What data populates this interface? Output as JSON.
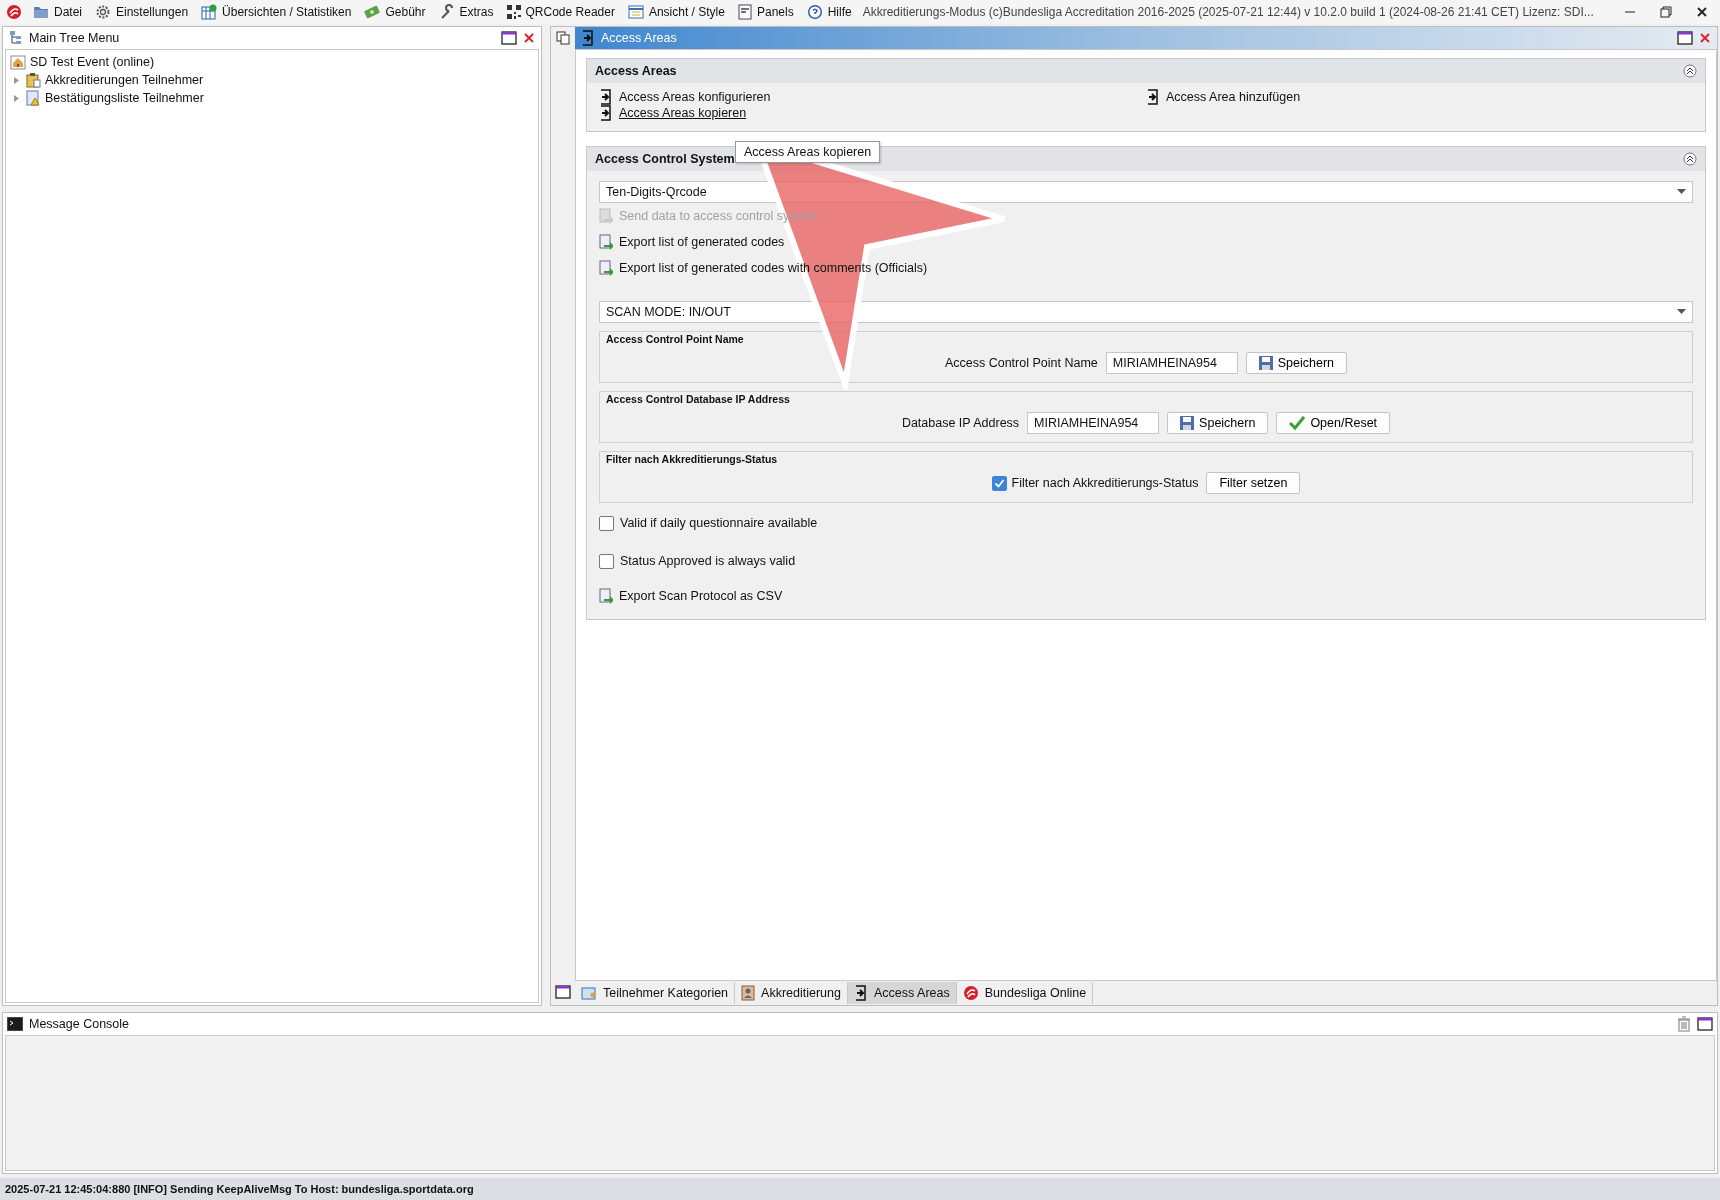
{
  "menu_bar": {
    "items": [
      {
        "label": "Datei"
      },
      {
        "label": "Einstellungen"
      },
      {
        "label": "Übersichten / Statistiken"
      },
      {
        "label": "Gebühr"
      },
      {
        "label": "Extras"
      },
      {
        "label": "QRCode Reader"
      },
      {
        "label": "Ansicht / Style"
      },
      {
        "label": "Panels"
      },
      {
        "label": "Hilfe"
      }
    ],
    "title": "Akkreditierungs-Modus (c)Bundesliga Accreditation 2016-2025 (2025-07-21 12:44) v 10.2.0 build 1 (2024-08-26 21:41 CET) Lizenz: SDI..."
  },
  "left_panel": {
    "title": "Main Tree Menu",
    "tree": [
      {
        "label": "SD Test Event (online)",
        "children": [
          {
            "label": "Akkreditierungen Teilnehmer",
            "expanded": false
          },
          {
            "label": "Bestätigungsliste Teilnehmer",
            "expanded": false
          }
        ]
      }
    ]
  },
  "main_panel": {
    "title": "Access Areas",
    "areas_section": {
      "title": "Access Areas",
      "links": [
        {
          "label": "Access Areas konfigurieren",
          "hovered": false
        },
        {
          "label": "Access Areas kopieren",
          "hovered": true
        }
      ],
      "right_link": {
        "label": "Access Area hinzufügen",
        "hovered": false
      },
      "tooltip": "Access Areas kopieren"
    },
    "acs_section": {
      "title": "Access Control System",
      "system": "Ten-Digits-Qrcode",
      "actions": [
        {
          "label": "Send data to access control system",
          "disabled": true
        },
        {
          "label": "Export list of generated codes",
          "disabled": false
        },
        {
          "label": "Export list of generated codes with comments (Officials)",
          "disabled": false
        }
      ],
      "scan_mode": "SCAN MODE: IN/OUT",
      "groups": [
        {
          "legend": "Access Control Point Name",
          "kind": "field",
          "label": "Access Control Point Name",
          "value": "MIRIAMHEINA954",
          "buttons": [
            {
              "label": "Speichern"
            }
          ]
        },
        {
          "legend": "Access Control Database IP Address",
          "kind": "field",
          "label": "Database IP Address",
          "value": "MIRIAMHEINA954",
          "buttons": [
            {
              "label": "Speichern"
            },
            {
              "label": "Open/Reset"
            }
          ]
        },
        {
          "legend": "Filter nach Akkreditierungs-Status",
          "kind": "checkbox",
          "label": "Filter nach Akkreditierungs-Status",
          "checked": true,
          "buttons": [
            {
              "label": "Filter setzen"
            }
          ]
        }
      ],
      "options": [
        {
          "label": "Valid if daily questionnaire available",
          "checked": false
        },
        {
          "label": "Status Approved is always valid",
          "checked": false
        }
      ],
      "export": {
        "label": "Export Scan Protocol as CSV",
        "disabled": false
      }
    },
    "tabs": [
      {
        "label": "Teilnehmer Kategorien",
        "selected": false
      },
      {
        "label": "Akkreditierung",
        "selected": false
      },
      {
        "label": "Access Areas",
        "selected": true
      },
      {
        "label": "Bundesliga Online",
        "selected": false
      }
    ]
  },
  "console": {
    "title": "Message Console"
  },
  "status_bar": "2025-07-21 12:45:04:880 [INFO] Sending KeepAliveMsg To Host: bundesliga.sportdata.org",
  "annotation": {
    "kind": "arrow"
  }
}
